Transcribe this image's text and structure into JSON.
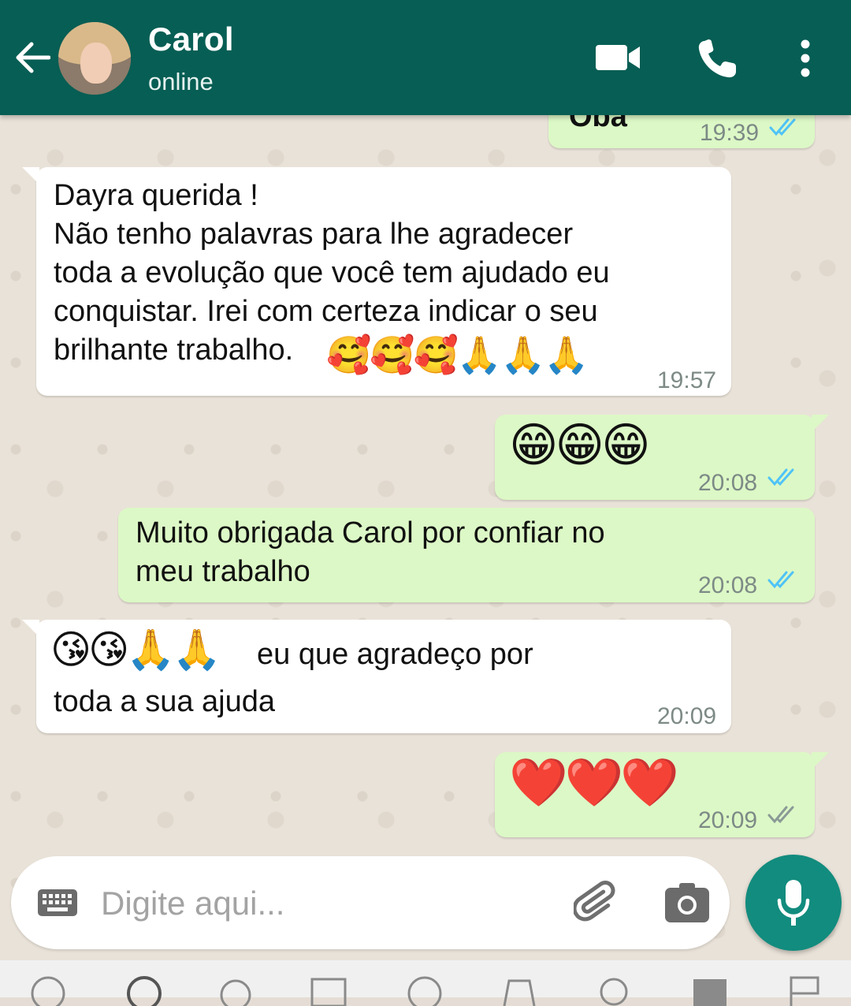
{
  "header": {
    "contact_name": "Carol",
    "status": "online",
    "bg_color": "#075e54"
  },
  "icons": {
    "back": "arrow-left-icon",
    "video": "video-camera-icon",
    "call": "phone-icon",
    "menu": "more-vert-icon",
    "keyboard": "keyboard-icon",
    "attach": "paperclip-icon",
    "camera": "camera-icon",
    "mic": "microphone-icon"
  },
  "messages": [
    {
      "direction": "out",
      "text": "Oba",
      "time": "19:39",
      "read": true
    },
    {
      "direction": "in",
      "text": "Dayra querida !\nNão tenho palavras para lhe agradecer\ntoda a evolução que você tem ajudado eu\nconquistar. Irei com certeza indicar o seu\nbrilhante trabalho.",
      "emojis": "🥰🥰🥰🙏🙏🙏",
      "time": "19:57"
    },
    {
      "direction": "out",
      "text": "",
      "emojis": "😁😁😁",
      "time": "20:08",
      "read": true
    },
    {
      "direction": "out",
      "text": "Muito obrigada Carol por confiar no\nmeu trabalho",
      "time": "20:08",
      "read": true
    },
    {
      "direction": "in",
      "emojis": "😘😘🙏🙏",
      "text": "eu que agradeço por",
      "text2": "toda a sua ajuda",
      "time": "20:09"
    },
    {
      "direction": "out",
      "text": "",
      "emojis": "❤️❤️❤️",
      "time": "20:09",
      "read": false
    }
  ],
  "composer": {
    "placeholder": "Digite aqui..."
  },
  "colors": {
    "incoming_bubble": "#ffffff",
    "outgoing_bubble": "#dcf8c6",
    "read_tick": "#4fc3f7",
    "unread_tick": "#8a9a96",
    "mic_button": "#128c7e"
  }
}
